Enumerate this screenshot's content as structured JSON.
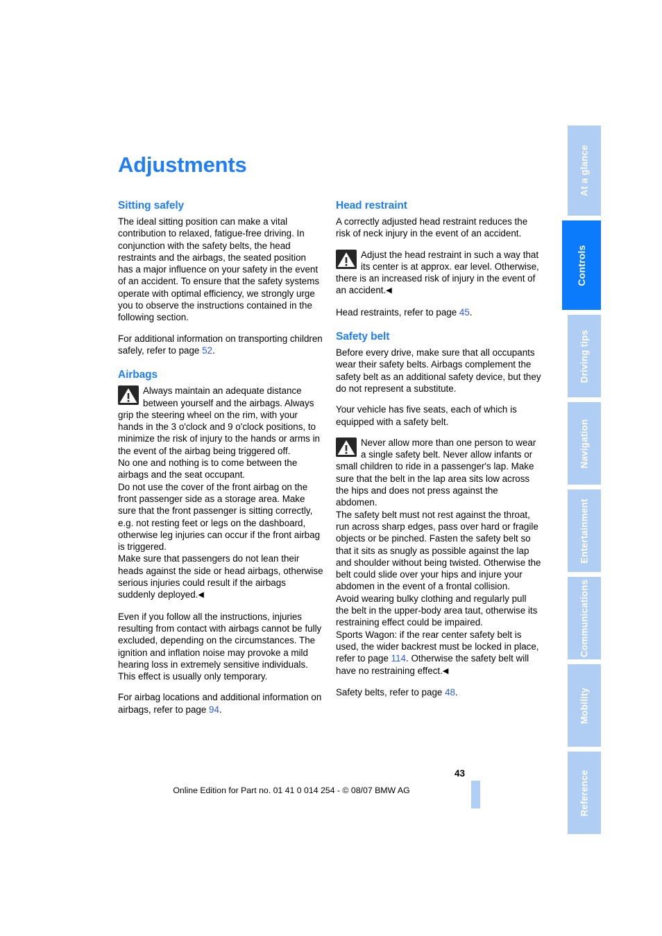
{
  "document": {
    "title": "Adjustments",
    "page_number": "43",
    "footer_note": "Online Edition for Part no. 01 41 0 014 254 - © 08/07 BMW AG"
  },
  "colors": {
    "heading_blue": "#1f7df8",
    "tab_active_blue": "#0b7bfb",
    "tab_inactive_blue": "#b0cdf4",
    "page_reference_blue": "#2a5ce8"
  },
  "tabs": [
    {
      "label": "At a glance",
      "active": false
    },
    {
      "label": "Controls",
      "active": true
    },
    {
      "label": "Driving tips",
      "active": false
    },
    {
      "label": "Navigation",
      "active": false
    },
    {
      "label": "Entertainment",
      "active": false
    },
    {
      "label": "Communications",
      "active": false
    },
    {
      "label": "Mobility",
      "active": false
    },
    {
      "label": "Reference",
      "active": false
    }
  ],
  "left_column": {
    "heading": "Sitting safely",
    "intro_para": "The ideal sitting position can make a vital contribution to relaxed, fatigue-free driving. In conjunction with the safety belts, the head restraints and the airbags, the seated position has a major influence on your safety in the event of an accident. To ensure that the safety systems operate with optimal efficiency, we strongly urge you to observe the instructions contained in the following section.",
    "children_para_before": "For additional information on transporting children safely, refer to page ",
    "children_page_ref": "52",
    "children_para_after": ".",
    "airbags_heading": "Airbags",
    "airbags_warning": "Always maintain an adequate distance between yourself and the airbags. Always grip the steering wheel on the rim, with your hands in the 3 o'clock and 9 o'clock positions, to minimize the risk of injury to the hands or arms in the event of the airbag being triggered off.\nNo one and nothing is to come between the airbags and the seat occupant.\nDo not use the cover of the front airbag on the front passenger side as a storage area. Make sure that the front passenger is sitting correctly, e.g. not resting feet or legs on the dashboard, otherwise leg injuries can occur if the front airbag is triggered.\nMake sure that passengers do not lean their heads against the side or head airbags, otherwise serious injuries could result if the airbags suddenly deployed.",
    "airbags_para2": "Even if you follow all the instructions, injuries resulting from contact with airbags cannot be fully excluded, depending on the circumstances. The ignition and inflation noise may provoke a mild hearing loss in extremely sensitive individuals. This effect is usually only temporary.",
    "airbags_locations_before": "For airbag locations and additional information on airbags, refer to page ",
    "airbags_page_ref": "94",
    "airbags_locations_after": "."
  },
  "right_column": {
    "head_restraint_heading": "Head restraint",
    "head_restraint_para": "A correctly adjusted head restraint reduces the risk of neck injury in the event of an accident.",
    "head_restraint_warning": "Adjust the head restraint in such a way that its center is at approx. ear level. Otherwise, there is an increased risk of injury in the event of an accident.",
    "head_restraint_ref_before": "Head restraints, refer to page ",
    "head_restraint_page_ref": "45",
    "head_restraint_ref_after": ".",
    "safety_belt_heading": "Safety belt",
    "safety_belt_para1": "Before every drive, make sure that all occupants wear their safety belts. Airbags complement the safety belt as an additional safety device, but they do not represent a substitute.",
    "safety_belt_para2": "Your vehicle has five seats, each of which is equipped with a safety belt.",
    "safety_belt_warning_part1": "Never allow more than one person to wear a single safety belt. Never allow infants or small children to ride in a passenger's lap. Make sure that the belt in the lap area sits low across the hips and does not press against the abdomen.\nThe safety belt must not rest against the throat, run across sharp edges, pass over hard or fragile objects or be pinched. Fasten the safety belt so that it sits as snugly as possible against the lap and shoulder without being twisted. Otherwise the belt could slide over your hips and injure your abdomen in the event of a frontal collision.\nAvoid wearing bulky clothing and regularly pull the belt in the upper-body area taut, otherwise its restraining effect could be impaired.\nSports Wagon: if the rear center safety belt is used, the wider backrest must be locked in place, refer to page ",
    "safety_belt_warning_page_ref": "114",
    "safety_belt_warning_part2": ". Otherwise the safety belt will have no restraining effect.",
    "safety_belt_ref_before": "Safety belts, refer to page ",
    "safety_belt_page_ref": "48",
    "safety_belt_ref_after": "."
  },
  "icons": {
    "warning_triangle": "warning-triangle-icon",
    "end_of_warning_marker": "◀"
  }
}
